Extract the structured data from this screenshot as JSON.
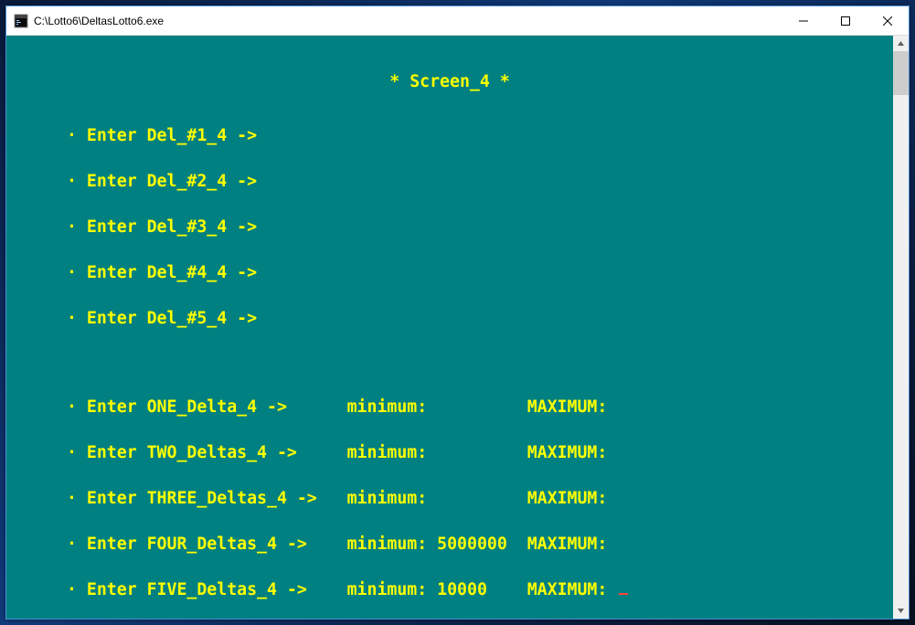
{
  "window": {
    "title": "C:\\Lotto6\\DeltasLotto6.exe"
  },
  "console": {
    "header": "* Screen_4 *",
    "bullet": "·",
    "del_prompts": [
      "Enter Del_#1_4 ->",
      "Enter Del_#2_4 ->",
      "Enter Del_#3_4 ->",
      "Enter Del_#4_4 ->",
      "Enter Del_#5_4 ->"
    ],
    "delta_rows": [
      {
        "prompt": "Enter ONE_Delta_4 ->   ",
        "min_label": "minimum:",
        "min_value": "",
        "max_label": "MAXIMUM:",
        "max_value": ""
      },
      {
        "prompt": "Enter TWO_Deltas_4 ->  ",
        "min_label": "minimum:",
        "min_value": "",
        "max_label": "MAXIMUM:",
        "max_value": ""
      },
      {
        "prompt": "Enter THREE_Deltas_4 ->  ",
        "min_label": "minimum:",
        "min_value": "",
        "max_label": "MAXIMUM:",
        "max_value": ""
      },
      {
        "prompt": "Enter FOUR_Deltas_4 ->   ",
        "min_label": "minimum: ",
        "min_value": "5000000",
        "max_label": "MAXIMUM:",
        "max_value": ""
      },
      {
        "prompt": "Enter FIVE_Deltas_4 ->   ",
        "min_label": "minimum: ",
        "min_value": "10000",
        "max_label": "MAXIMUM:",
        "max_value": "",
        "cursor": true
      }
    ]
  }
}
